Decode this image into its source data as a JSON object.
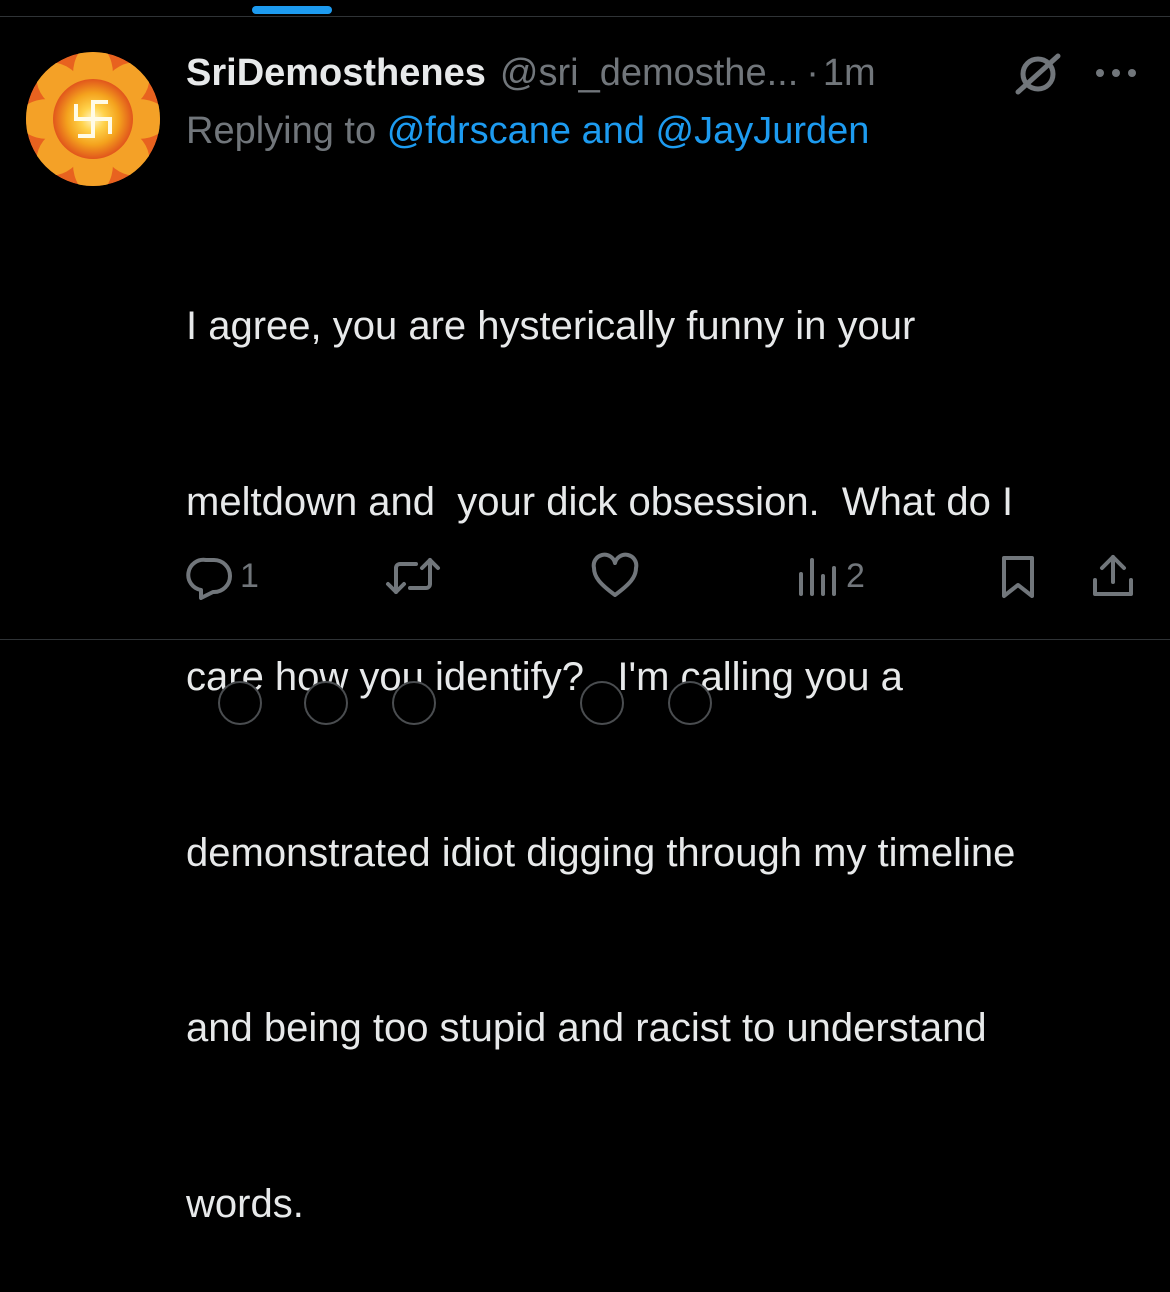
{
  "tweet": {
    "display_name": "SriDemosthenes",
    "handle": "@sri_demosthe...",
    "separator": "·",
    "time": "1m",
    "reply_prefix": "Replying to",
    "reply_mention_1": "@fdrscane",
    "reply_joiner": "and",
    "reply_mention_2": "@JayJurden",
    "text_lines": [
      "I agree, you are hysterically funny in your",
      "meltdown and  your dick obsession.  What do I",
      "care how you identify?   I'm calling you a",
      "demonstrated idiot digging through my timeline",
      "and being too stupid and racist to understand",
      "words."
    ]
  },
  "actions": {
    "reply_count": "1",
    "views_count": "2"
  },
  "icons": {
    "avatar": "swastika-lotus-avatar",
    "grok": "grok-icon",
    "more": "more-icon",
    "reply": "reply-icon",
    "retweet": "retweet-icon",
    "like": "like-icon",
    "views": "views-icon",
    "bookmark": "bookmark-icon",
    "share": "share-icon"
  },
  "colors": {
    "background": "#000000",
    "text": "#e7e9ea",
    "muted": "#71767b",
    "link": "#1d9bf0",
    "divider": "#2f3336"
  }
}
